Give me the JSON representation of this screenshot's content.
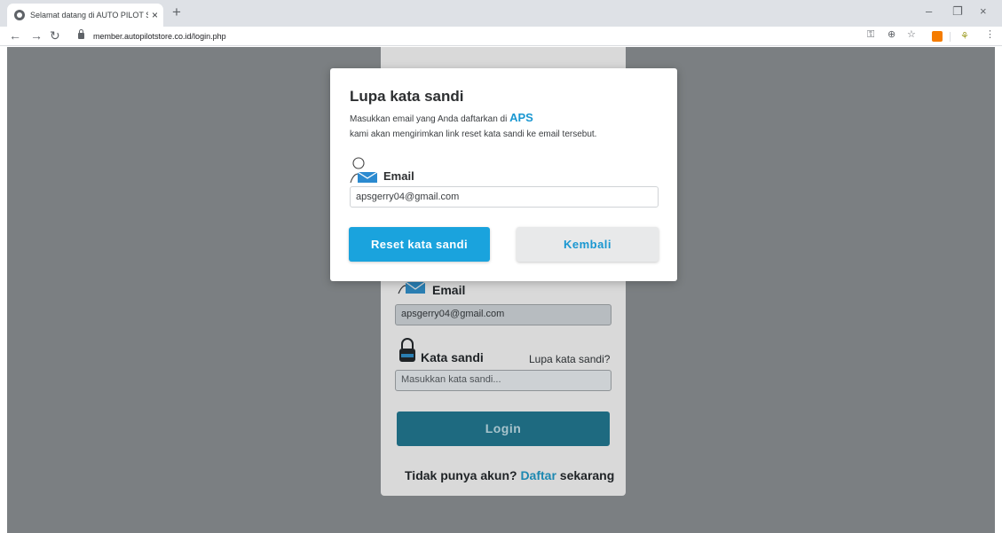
{
  "browser": {
    "tab_title": "Selamat datang di AUTO PILOT S",
    "tab_close": "×",
    "new_tab": "+",
    "url": "member.autopilotstore.co.id/login.php",
    "window_controls": [
      "–",
      "❐",
      "×"
    ]
  },
  "modal": {
    "title": "Lupa kata sandi",
    "description_prefix": "Masukkan email yang Anda daftarkan di",
    "brand": "APS",
    "description_line2": "kami akan mengirimkan link reset kata sandi ke email tersebut.",
    "email_label": "Email",
    "email_value": "apsgerry04@gmail.com",
    "reset_button": "Reset kata sandi",
    "back_button": "Kembali"
  },
  "login_card": {
    "email_label": "Email",
    "email_value": "apsgerry04@gmail.com",
    "password_label": "Kata sandi",
    "forgot_link": "Lupa kata sandi?",
    "password_placeholder": "Masukkan kata sandi...",
    "login_button": "Login",
    "signup_prefix": "Tidak punya akun?",
    "signup_link": "Daftar",
    "signup_suffix": "sekarang"
  },
  "colors": {
    "overlay": "#7b7f82",
    "accent": "#1aa3dd",
    "login_button": "#1e6a80"
  }
}
